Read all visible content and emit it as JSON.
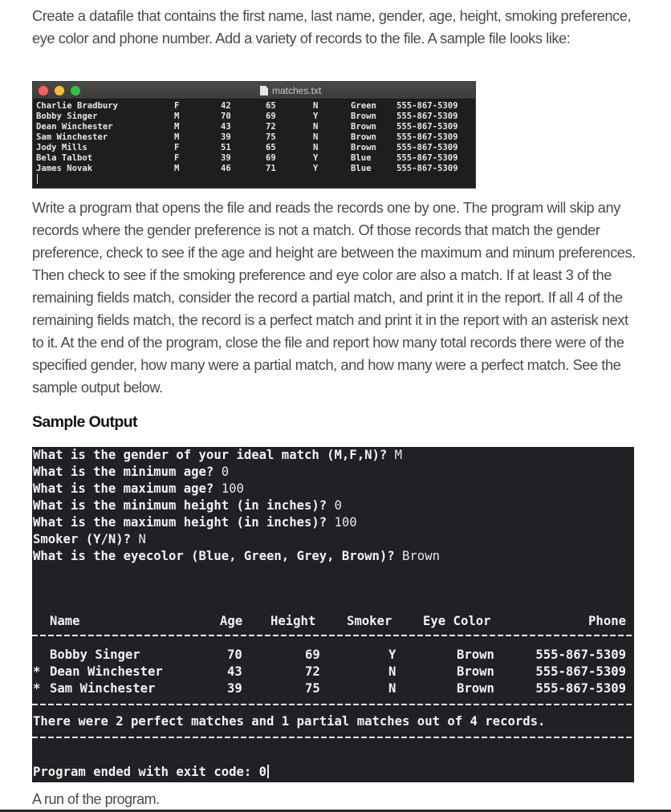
{
  "intro": {
    "text": "Create a datafile that contains the first name, last name, gender, age, height, smoking preference, eye color and phone number. Add a variety of records to the file. A sample file looks like:"
  },
  "file_window": {
    "title": "matches.txt",
    "icon": "document-icon",
    "traffic_lights": {
      "close": "#ff5f57",
      "minimize": "#febc2e",
      "maximize": "#28c840"
    },
    "records": [
      {
        "name": "Charlie Bradbury",
        "gender": "F",
        "age": "42",
        "height": "65",
        "smoker": "N",
        "eye": "Green",
        "phone": "555-867-5309"
      },
      {
        "name": "Bobby Singer",
        "gender": "M",
        "age": "70",
        "height": "69",
        "smoker": "Y",
        "eye": "Brown",
        "phone": "555-867-5309"
      },
      {
        "name": "Dean Winchester",
        "gender": "M",
        "age": "43",
        "height": "72",
        "smoker": "N",
        "eye": "Brown",
        "phone": "555-867-5309"
      },
      {
        "name": "Sam Winchester",
        "gender": "M",
        "age": "39",
        "height": "75",
        "smoker": "N",
        "eye": "Brown",
        "phone": "555-867-5309"
      },
      {
        "name": "Jody Mills",
        "gender": "F",
        "age": "51",
        "height": "65",
        "smoker": "N",
        "eye": "Brown",
        "phone": "555-867-5309"
      },
      {
        "name": "Bela Talbot",
        "gender": "F",
        "age": "39",
        "height": "69",
        "smoker": "Y",
        "eye": "Blue",
        "phone": "555-867-5309"
      },
      {
        "name": "James Novak",
        "gender": "M",
        "age": "46",
        "height": "71",
        "smoker": "Y",
        "eye": "Blue",
        "phone": "555-867-5309"
      }
    ]
  },
  "description": {
    "text": "Write a program that opens the file and reads the records one by one. The program will skip any records where the gender preference is not a match. Of those records that match the gender preference, check to see if the age and height are between the maximum and minum preferences. Then check to see if the smoking preference and eye color are also a match. If at least 3 of the remaining fields match, consider the record a partial match, and print it in the report. If all 4 of the remaining fields match, the record is a perfect match and print it in the report with an asterisk next to it. At the end of the program, close the file and report how many total records there were of the specified gender, how many were a partial match, and how many were a perfect match. See the sample output below."
  },
  "sample_heading": "Sample Output",
  "terminal": {
    "prompts": [
      {
        "q": "What is the gender of your ideal match (M,F,N)? ",
        "a": "M"
      },
      {
        "q": "What is the minimum age? ",
        "a": "0"
      },
      {
        "q": "What is the maximum age? ",
        "a": "100"
      },
      {
        "q": "What is the minimum height (in inches)? ",
        "a": "0"
      },
      {
        "q": "What is the maximum height (in inches)? ",
        "a": "100"
      },
      {
        "q": "Smoker (Y/N)? ",
        "a": "N"
      },
      {
        "q": "What is the eyecolor (Blue, Green, Grey, Brown)? ",
        "a": "Brown"
      }
    ],
    "report_headers": {
      "name": "Name",
      "age": "Age",
      "height": "Height",
      "smoker": "Smoker",
      "eye": "Eye Color",
      "phone": "Phone"
    },
    "report_rows": [
      {
        "marker": " ",
        "name": "Bobby Singer",
        "age": "70",
        "height": "69",
        "smoker": "Y",
        "eye": "Brown",
        "phone": "555-867-5309"
      },
      {
        "marker": "*",
        "name": "Dean Winchester",
        "age": "43",
        "height": "72",
        "smoker": "N",
        "eye": "Brown",
        "phone": "555-867-5309"
      },
      {
        "marker": "*",
        "name": "Sam Winchester",
        "age": "39",
        "height": "75",
        "smoker": "N",
        "eye": "Brown",
        "phone": "555-867-5309"
      }
    ],
    "summary": "There were 2 perfect matches and 1 partial matches out of 4 records.",
    "exit_message": "Program ended with exit code: 0"
  },
  "caption": "A run of the program."
}
